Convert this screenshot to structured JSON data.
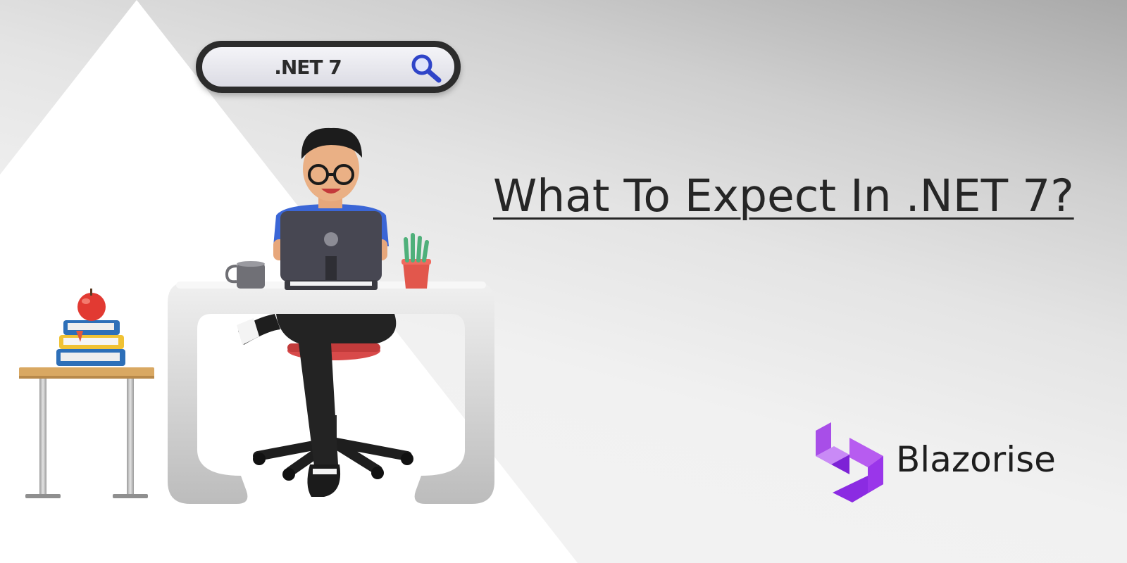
{
  "search": {
    "query": ".NET 7"
  },
  "headline": "What To Expect In .NET 7?",
  "brand": {
    "name": "Blazorise"
  },
  "icons": {
    "search": "magnifier-icon",
    "logo": "blazorise-logo-icon"
  },
  "colors": {
    "brand_purple": "#8b2be2",
    "brand_purple_light": "#b75cf0",
    "search_icon_blue": "#2f44c8",
    "text_dark": "#262626"
  }
}
